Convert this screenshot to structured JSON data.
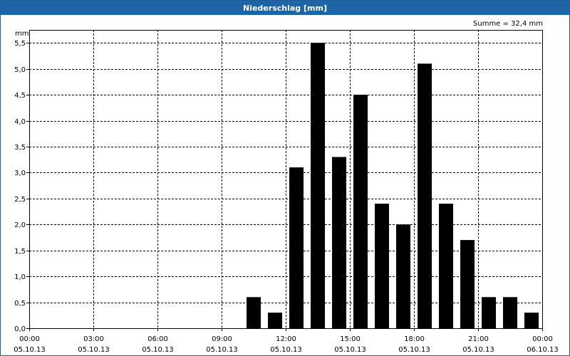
{
  "window": {
    "title": "Niederschlag [mm]"
  },
  "chart_data": {
    "type": "bar",
    "title": "Niederschlag [mm]",
    "ylabel": "mm",
    "annotation": "Summe = 32,4 mm",
    "ylim": [
      0,
      5.75
    ],
    "xlim_hours": [
      0,
      24
    ],
    "grid": true,
    "legend": "none",
    "bar_color": "#000000",
    "y_ticks": [
      "0,0",
      "0,5",
      "1,0",
      "1,5",
      "2,0",
      "2,5",
      "3,0",
      "3,5",
      "4,0",
      "4,5",
      "5,0",
      "5,5"
    ],
    "y_tick_values": [
      0,
      0.5,
      1,
      1.5,
      2,
      2.5,
      3,
      3.5,
      4,
      4.5,
      5,
      5.5
    ],
    "x_ticks": [
      {
        "time": "00:00",
        "date": "05.10.13",
        "hour": 0
      },
      {
        "time": "03:00",
        "date": "05.10.13",
        "hour": 3
      },
      {
        "time": "06:00",
        "date": "05.10.13",
        "hour": 6
      },
      {
        "time": "09:00",
        "date": "05.10.13",
        "hour": 9
      },
      {
        "time": "12:00",
        "date": "05.10.13",
        "hour": 12
      },
      {
        "time": "15:00",
        "date": "05.10.13",
        "hour": 15
      },
      {
        "time": "18:00",
        "date": "05.10.13",
        "hour": 18
      },
      {
        "time": "21:00",
        "date": "05.10.13",
        "hour": 21
      },
      {
        "time": "00:00",
        "date": "06.10.13",
        "hour": 24
      }
    ],
    "x_hours": [
      10.5,
      11.5,
      12.5,
      13.5,
      14.5,
      15.5,
      16.5,
      17.5,
      18.5,
      19.5,
      20.5,
      21.5,
      22.5,
      23.5
    ],
    "values": [
      0.6,
      0.3,
      3.1,
      5.5,
      3.3,
      4.5,
      2.4,
      2.0,
      5.1,
      2.4,
      1.7,
      0.6,
      0.6,
      0.3
    ]
  }
}
